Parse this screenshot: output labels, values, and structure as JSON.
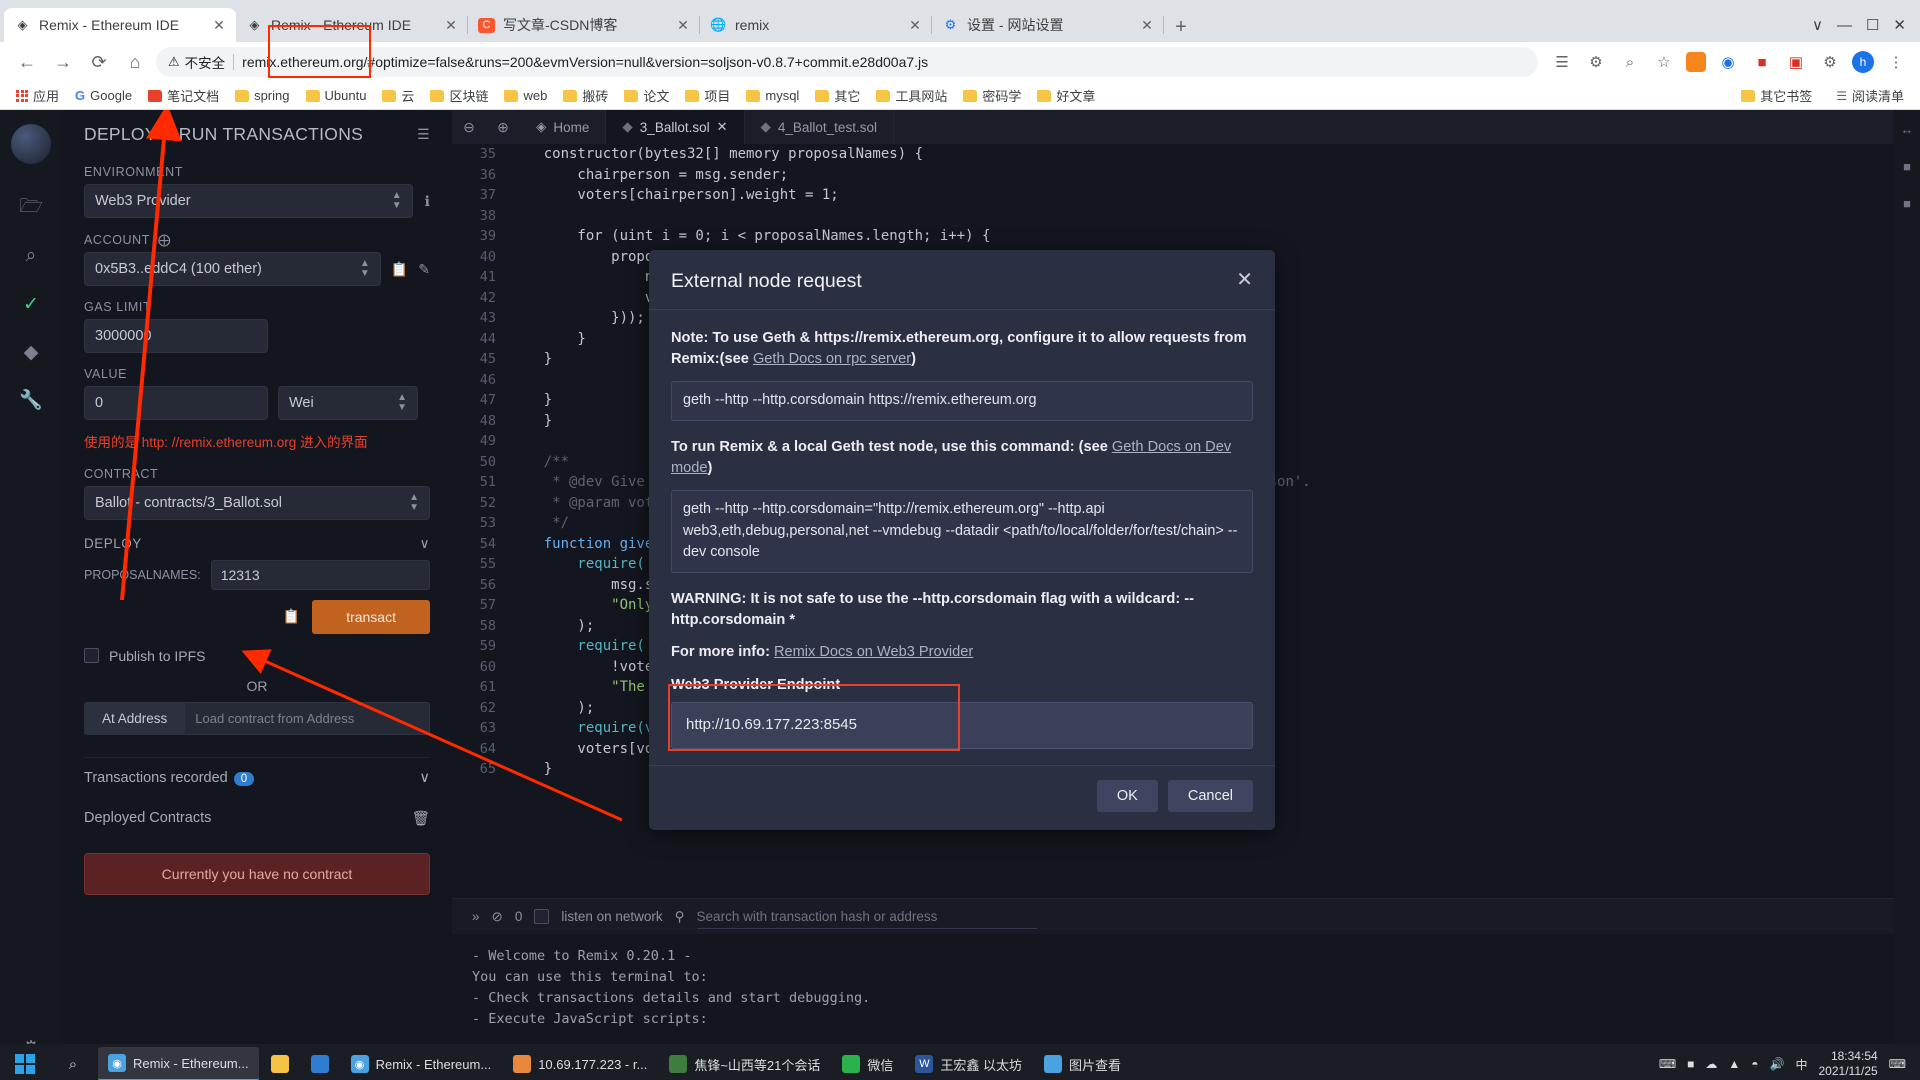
{
  "browser": {
    "tabs": [
      {
        "title": "Remix - Ethereum IDE",
        "icon": "ethereum-icon",
        "close": "✕",
        "active": true
      },
      {
        "title": "Remix - Ethereum IDE",
        "icon": "ethereum-icon",
        "close": "✕",
        "active": false
      },
      {
        "title": "写文章-CSDN博客",
        "icon": "csdn-icon",
        "close": "✕",
        "active": false
      },
      {
        "title": "remix",
        "icon": "globe-icon",
        "close": "✕",
        "active": false
      },
      {
        "title": "设置 - 网站设置",
        "icon": "settings-icon",
        "close": "✕",
        "active": false
      }
    ],
    "new_tab_label": "+",
    "window_controls": {
      "minimize": "—",
      "maximize": "☐",
      "close": "✕",
      "chevron": "∨"
    },
    "nav": {
      "back": "←",
      "forward": "→",
      "reload": "⟳",
      "home": "⌂"
    },
    "omnibox": {
      "security_label": "不安全",
      "security_icon": "⚠",
      "url": "remix.ethereum.org/#optimize=false&runs=200&evmVersion=null&version=soljson-v0.8.7+commit.e28d00a7.js"
    },
    "toolbar_icons": [
      "reading-list-icon",
      "extensions-icon",
      "zoom-icon",
      "bookmark-star-icon",
      "metamask-icon",
      "extension-c-icon",
      "extension-red-icon",
      "extension-red2-icon",
      "puzzle-icon",
      "profile-avatar",
      "menu-icon"
    ],
    "profile_initial": "h",
    "bookmarks": [
      {
        "label": "应用",
        "icon": "apps-grid-icon"
      },
      {
        "label": "Google",
        "icon": "google-icon"
      },
      {
        "label": "笔记文档",
        "icon": "red-folder-icon"
      },
      {
        "label": "spring",
        "icon": "folder-icon"
      },
      {
        "label": "Ubuntu",
        "icon": "folder-icon"
      },
      {
        "label": "云",
        "icon": "folder-icon"
      },
      {
        "label": "区块链",
        "icon": "folder-icon"
      },
      {
        "label": "web",
        "icon": "folder-icon"
      },
      {
        "label": "搬砖",
        "icon": "folder-icon"
      },
      {
        "label": "论文",
        "icon": "folder-icon"
      },
      {
        "label": "项目",
        "icon": "folder-icon"
      },
      {
        "label": "mysql",
        "icon": "folder-icon"
      },
      {
        "label": "其它",
        "icon": "folder-icon"
      },
      {
        "label": "工具网站",
        "icon": "folder-icon"
      },
      {
        "label": "密码学",
        "icon": "folder-icon"
      },
      {
        "label": "好文章",
        "icon": "folder-icon"
      }
    ],
    "bookmarks_right": [
      {
        "label": "其它书签",
        "icon": "folder-icon"
      },
      {
        "label": "阅读清单",
        "icon": "reading-list-icon"
      }
    ]
  },
  "remix": {
    "panel_title": "DEPLOY & RUN TRANSACTIONS",
    "panel_menu_icon": "hamburger-icon",
    "environment_label": "ENVIRONMENT",
    "environment_value": "Web3 Provider",
    "environment_info_icon": "info-icon",
    "account_label": "ACCOUNT",
    "account_plus_icon": "plus-circle-icon",
    "account_value": "0x5B3..eddC4 (100 ether)",
    "account_copy_icon": "copy-icon",
    "account_edit_icon": "edit-icon",
    "gas_limit_label": "GAS LIMIT",
    "gas_limit_value": "3000000",
    "value_label": "VALUE",
    "value_amount": "0",
    "value_unit": "Wei",
    "annotation_cn": "使用的是 http: //remix.ethereum.org 进入的界面",
    "contract_label": "CONTRACT",
    "contract_value": "Ballot - contracts/3_Ballot.sol",
    "deploy_label": "DEPLOY",
    "proposal_label": "PROPOSALNAMES:",
    "proposal_value": "12313",
    "transact_label": "transact",
    "transact_copy_icon": "copy-icon",
    "publish_ipfs_label": "Publish to IPFS",
    "or_label": "OR",
    "at_address_label": "At Address",
    "at_address_placeholder": "Load contract from Address",
    "transactions_recorded_label": "Transactions recorded",
    "transactions_recorded_count": "0",
    "deployed_contracts_label": "Deployed Contracts",
    "deployed_contracts_trash_icon": "trash-icon",
    "no_contract_label": "Currently you have no contract",
    "chevron_icon": "∨",
    "settings_icon": "gear-icon",
    "editor_tabs": [
      {
        "label": "Home",
        "icon": "remix-logo-icon",
        "closable": false,
        "active": false
      },
      {
        "label": "3_Ballot.sol",
        "icon": "solidity-icon",
        "closable": true,
        "active": true
      },
      {
        "label": "4_Ballot_test.sol",
        "icon": "solidity-icon",
        "closable": false,
        "active": false
      }
    ],
    "editor_tools": {
      "zoom_out": "⊖",
      "zoom_in": "⊕",
      "search": "⚲"
    },
    "code_lines": [
      {
        "n": "35",
        "text": "    constructor(bytes32[] memory proposalNames) {"
      },
      {
        "n": "36",
        "text": "        chairperson = msg.sender;"
      },
      {
        "n": "37",
        "text": "        voters[chairperson].weight = 1;"
      },
      {
        "n": "38",
        "text": ""
      },
      {
        "n": "39",
        "text": "        for (uint i = 0; i < proposalNames.length; i++) {"
      },
      {
        "n": "40",
        "text": "            proposals.push(Proposal({"
      },
      {
        "n": "41",
        "text": "                name: proposalNames[i],"
      },
      {
        "n": "42",
        "text": "                voteCount: 0"
      },
      {
        "n": "43",
        "text": "            }));"
      },
      {
        "n": "44",
        "text": "        }"
      },
      {
        "n": "45",
        "text": "    }"
      },
      {
        "n": "46",
        "text": ""
      },
      {
        "n": "47",
        "text": "    }"
      },
      {
        "n": "48",
        "text": "    }"
      },
      {
        "n": "49",
        "text": ""
      },
      {
        "n": "50",
        "text": "    /**"
      },
      {
        "n": "51",
        "text": "     * @dev Give 'voter' the right to vote on this ballot. May only be called by 'chairperson'."
      },
      {
        "n": "52",
        "text": "     * @param voter address of voter"
      },
      {
        "n": "53",
        "text": "     */"
      },
      {
        "n": "54",
        "text": "    function giveRightToVote(address voter) public {"
      },
      {
        "n": "55",
        "text": "        require("
      },
      {
        "n": "56",
        "text": "            msg.sender == chairperson,"
      },
      {
        "n": "57",
        "text": "            \"Only chairperson can give right to vote.\""
      },
      {
        "n": "58",
        "text": "        );"
      },
      {
        "n": "59",
        "text": "        require("
      },
      {
        "n": "60",
        "text": "            !voters[voter].voted,"
      },
      {
        "n": "61",
        "text": "            \"The voter already voted.\""
      },
      {
        "n": "62",
        "text": "        );"
      },
      {
        "n": "63",
        "text": "        require(voters[voter].weight == 0);"
      },
      {
        "n": "64",
        "text": "        voters[voter].weight = 1;"
      },
      {
        "n": "65",
        "text": "    }"
      }
    ],
    "terminal_bar": {
      "expand_icon": "»",
      "block_icon": "⊘",
      "count": "0",
      "listen_label": "listen on network",
      "search_icon": "⚲",
      "search_placeholder": "Search with transaction hash or address"
    },
    "terminal_lines": [
      "- Welcome to Remix 0.20.1 -",
      "You can use this terminal to:",
      " - Check transactions details and start debugging.",
      " - Execute JavaScript scripts:"
    ]
  },
  "modal": {
    "title": "External node request",
    "close_icon": "✕",
    "note_prefix": "Note",
    "note_text": ": To use Geth & https://remix.ethereum.org, configure it to allow requests from Remix:(see ",
    "note_link": "Geth Docs on rpc server",
    "note_suffix": ")",
    "cmd1": "geth --http --http.corsdomain https://remix.ethereum.org",
    "run_text": "To run Remix & a local Geth test node, use this command: (see ",
    "run_link": "Geth Docs on Dev mode",
    "run_suffix": ")",
    "cmd2": "geth --http --http.corsdomain=\"http://remix.ethereum.org\" --http.api web3,eth,debug,personal,net --vmdebug --datadir <path/to/local/folder/for/test/chain> --dev console",
    "warning": "WARNING: It is not safe to use the --http.corsdomain flag with a wildcard: --http.corsdomain *",
    "more_info_prefix": "For more info",
    "more_info_link": "Remix Docs on Web3 Provider",
    "endpoint_label": "Web3 Provider Endpoint",
    "endpoint_value": "http://10.69.177.223:8545",
    "ok_label": "OK",
    "cancel_label": "Cancel"
  },
  "taskbar": {
    "start_icon": "windows-icon",
    "search_icon": "⌕",
    "items": [
      {
        "label": "Remix - Ethereum...",
        "icon": "chrome-icon",
        "color": "#4aa3e0",
        "active": true
      },
      {
        "label": "",
        "icon": "file-explorer-icon",
        "color": "#f5c344",
        "active": false
      },
      {
        "label": "",
        "icon": "vscode-icon",
        "color": "#2f7dd1",
        "active": false
      },
      {
        "label": "Remix - Ethereum...",
        "icon": "chrome-icon",
        "color": "#4aa3e0",
        "active": false
      },
      {
        "label": "10.69.177.223 - r...",
        "icon": "terminal-icon",
        "color": "#e8883a",
        "active": false
      },
      {
        "label": "焦锋~山西等21个会话",
        "icon": "xshell-icon",
        "color": "#3f7d3f",
        "active": false
      },
      {
        "label": "微信",
        "icon": "wechat-icon",
        "color": "#2bb24c",
        "active": false
      },
      {
        "label": "王宏鑫 以太坊",
        "icon": "word-icon",
        "color": "#2b579a",
        "active": false
      },
      {
        "label": "图片查看",
        "icon": "photo-icon",
        "color": "#4aa3e0",
        "active": false
      }
    ],
    "tray_icons": [
      "ime-icon",
      "network-tray-icon",
      "onedrive-icon",
      "chevron-up-icon",
      "wifi-icon",
      "volume-icon",
      "lang-icon"
    ],
    "clock_time": "18:34:54",
    "clock_date": "2021/11/25",
    "notification_icon": "⌨"
  },
  "colors": {
    "accent_orange": "#c1621f",
    "annotation_red": "#e8402a",
    "modal_bg": "#2b2f42",
    "panel_bg": "#14161f",
    "link": "#adb3c4"
  }
}
